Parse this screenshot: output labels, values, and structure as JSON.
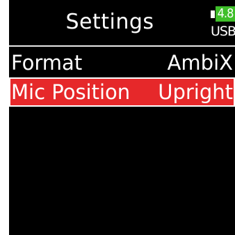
{
  "header": {
    "title": "Settings"
  },
  "battery": {
    "value": "4.8",
    "source": "USB",
    "color": "#3fbf2a"
  },
  "menu": {
    "items": [
      {
        "label": "Format",
        "value": "AmbiX",
        "selected": false
      },
      {
        "label": "Mic Position",
        "value": "Upright",
        "selected": true
      }
    ],
    "highlight_color": "#e6282a"
  }
}
